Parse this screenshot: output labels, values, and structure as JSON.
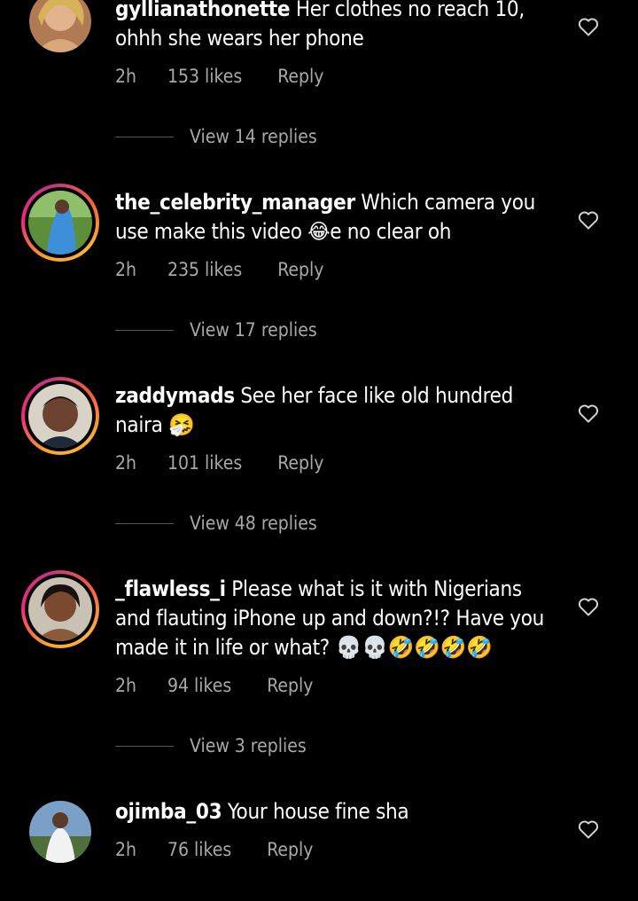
{
  "comments": [
    {
      "username": "gyllianathonette",
      "text": "Her clothes no reach 10, ohhh she wears her phone",
      "time": "2h",
      "likes": "153 likes",
      "reply": "Reply",
      "view_replies": "View 14 replies"
    },
    {
      "username": "the_celebrity_manager",
      "text_before_emoji": "Which camera you use make this video",
      "emoji": "😂",
      "text_after_emoji": "e no clear oh",
      "time": "2h",
      "likes": "235 likes",
      "reply": "Reply",
      "view_replies": "View 17 replies"
    },
    {
      "username": "zaddymads",
      "text": "See her face like old hundred naira",
      "emoji": "🤧",
      "time": "2h",
      "likes": "101 likes",
      "reply": "Reply",
      "view_replies": "View 48 replies"
    },
    {
      "username": "_flawless_i",
      "text": "Please what is it with Nigerians and flauting iPhone up and down?!? Have you made it in life or what?",
      "emoji": "💀💀🤣🤣🤣🤣",
      "time": "2h",
      "likes": "94 likes",
      "reply": "Reply",
      "view_replies": "View 3 replies"
    },
    {
      "username": "ojimba_03",
      "text": "Your house fine sha",
      "time": "2h",
      "likes": "76 likes",
      "reply": "Reply"
    }
  ]
}
